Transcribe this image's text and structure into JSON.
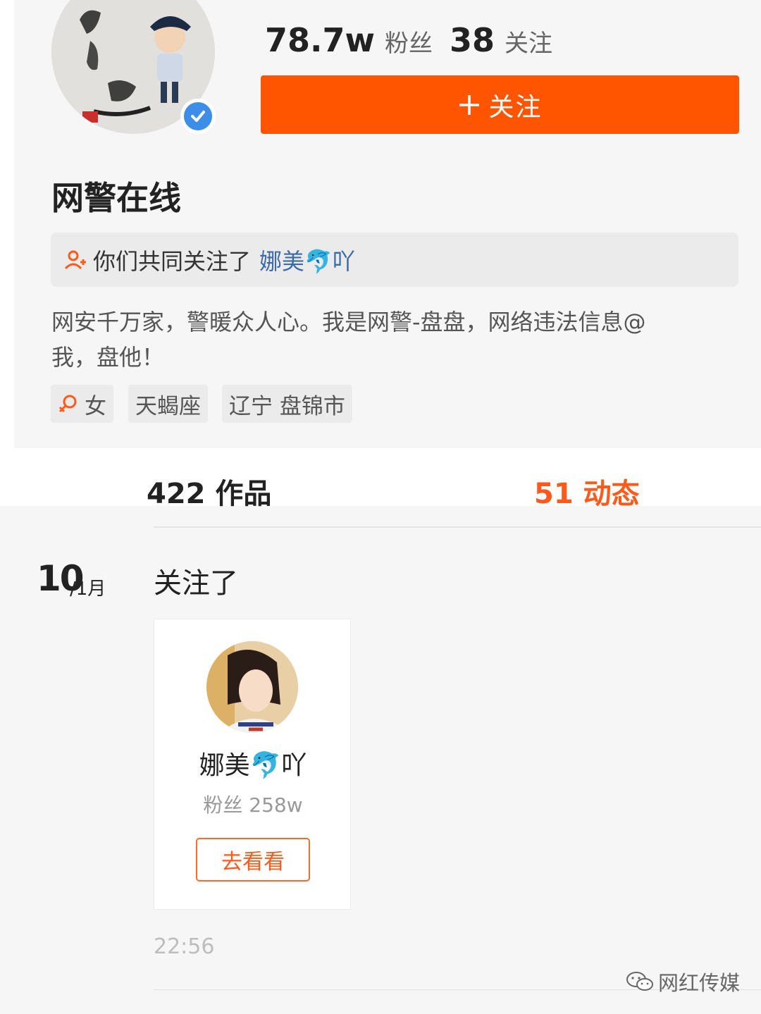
{
  "profile": {
    "fans_count": "78.7w",
    "fans_label": "粉丝",
    "following_count": "38",
    "following_label": "关注",
    "follow_button": "关注",
    "name": "网警在线",
    "avatar_icon": "police-cartoon-avatar",
    "verified_icon": "verified-check-icon"
  },
  "mutual": {
    "text": "你们共同关注了",
    "user": "娜美🐬吖"
  },
  "bio": {
    "line1": "网安千万家，警暖众人心。我是网警-盘盘，网络违法信息@",
    "line2": "我，盘他！"
  },
  "tags": {
    "gender": "女",
    "zodiac": "天蝎座",
    "location": "辽宁 盘锦市"
  },
  "tabs": {
    "works": "422 作品",
    "moments": "51 动态"
  },
  "feed": {
    "date_day": "10",
    "date_month": "/1月",
    "action": "关注了",
    "card": {
      "name": "娜美🐬吖",
      "fans": "粉丝 258w",
      "button": "去看看"
    },
    "time": "22:56"
  },
  "watermark": "网红传媒",
  "colors": {
    "accent": "#ff5500",
    "link": "#3b6aa6",
    "verified": "#3d8ee8",
    "background": "#f6f6f6"
  }
}
